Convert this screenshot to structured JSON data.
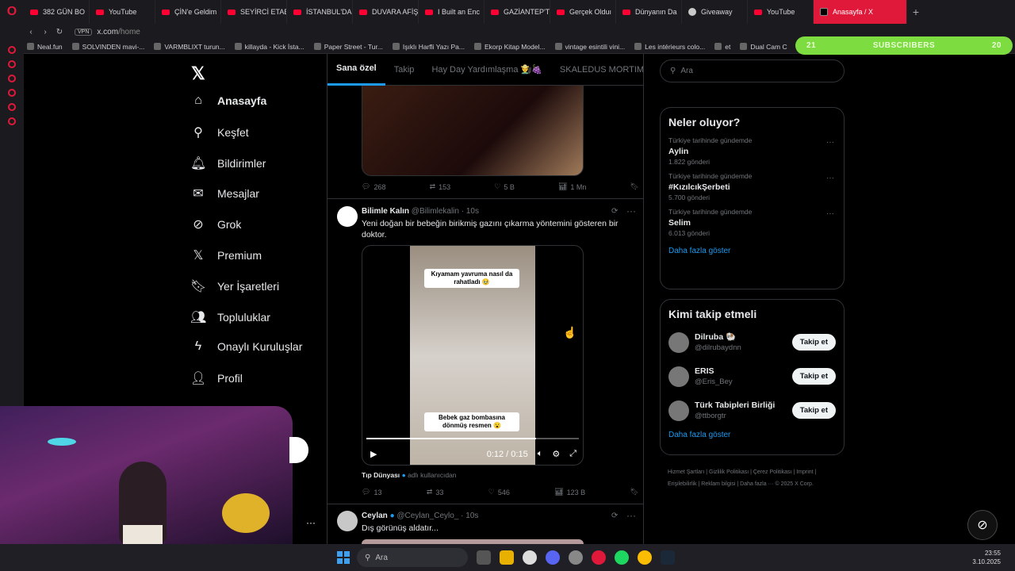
{
  "browser": {
    "tabs": [
      {
        "label": "382 GÜN BO",
        "icon": "yt"
      },
      {
        "label": "YouTube",
        "icon": "yt"
      },
      {
        "label": "ÇİN'e Geldim",
        "icon": "yt"
      },
      {
        "label": "SEYİRCİ ETAB",
        "icon": "yt"
      },
      {
        "label": "İSTANBUL'DA",
        "icon": "yt"
      },
      {
        "label": "DUVARA AFİŞ",
        "icon": "yt"
      },
      {
        "label": "I Built an Enc",
        "icon": "yt"
      },
      {
        "label": "GAZİANTEP'T",
        "icon": "yt"
      },
      {
        "label": "Gerçek Olduı",
        "icon": "yt"
      },
      {
        "label": "Dünyanın Da",
        "icon": "yt"
      },
      {
        "label": "Giveaway",
        "icon": "gh"
      },
      {
        "label": "YouTube",
        "icon": "yt"
      },
      {
        "label": "Anasayfa / X",
        "icon": "x",
        "active": true
      }
    ],
    "vpn": "VPN",
    "url_host": "x.com",
    "url_path": "/home",
    "bookmarks": [
      "Neal.fun",
      "SOLVINDEN mavi-...",
      "VARMBLIXT turun...",
      "killayda - Kick İsta...",
      "Paper Street - Tur...",
      "Işıklı Harfli Yazı Pa...",
      "Ekorp Kitap Model...",
      "vintage esintili vini...",
      "Les intérieurs colo...",
      "et",
      "Dual Cam C"
    ]
  },
  "subs": {
    "left": "21",
    "label": "SUBSCRIBERS",
    "right": "20"
  },
  "nav": [
    {
      "label": "Anasayfa",
      "icon": "home-icon",
      "glyph": "⌂"
    },
    {
      "label": "Keşfet",
      "icon": "search-icon",
      "glyph": "⚲"
    },
    {
      "label": "Bildirimler",
      "icon": "bell-icon",
      "glyph": "🔔︎"
    },
    {
      "label": "Mesajlar",
      "icon": "mail-icon",
      "glyph": "✉"
    },
    {
      "label": "Grok",
      "icon": "grok-icon",
      "glyph": "⊘"
    },
    {
      "label": "Premium",
      "icon": "x-icon",
      "glyph": "𝕏"
    },
    {
      "label": "Yer İşaretleri",
      "icon": "bookmark-icon",
      "glyph": "🔖︎"
    },
    {
      "label": "Topluluklar",
      "icon": "people-icon",
      "glyph": "👥︎"
    },
    {
      "label": "Onaylı Kuruluşlar",
      "icon": "bolt-icon",
      "glyph": "ϟ"
    },
    {
      "label": "Profil",
      "icon": "person-icon",
      "glyph": "👤︎"
    }
  ],
  "timeline": {
    "tabs": [
      "Sana özel",
      "Takip",
      "Hay Day Yardımlaşma 👨‍🌾🍇",
      "SKALEDUS MORTIMAS"
    ],
    "post1": {
      "replies": "268",
      "reposts": "153",
      "likes": "5 B",
      "views": "1 Mn"
    },
    "post2": {
      "name": "Bilimle Kalın",
      "handle": "@Bilimlekalin · 10s",
      "text": "Yeni doğan bir bebeğin birikmiş gazını çıkarma yöntemini gösteren bir doktor.",
      "cap_top": "Kıyamam yavruma nasıl da rahatladı 🥹",
      "cap_bottom": "Bebek gaz bombasına dönmüş resmen 😮",
      "time": "0:12 / 0:15",
      "progress": 0.8,
      "source_name": "Tıp Dünyası",
      "source_suffix": "adlı kullanıcıdan",
      "replies": "13",
      "reposts": "33",
      "likes": "546",
      "views": "123 B"
    },
    "post3": {
      "name": "Ceylan",
      "handle": "@Ceylan_Ceylo_ · 10s",
      "text": "Dış görünüş aldatır..."
    }
  },
  "right": {
    "search_placeholder": "Ara",
    "trends_title": "Neler oluyor?",
    "trends": [
      {
        "context": "Türkiye tarihinde gündemde",
        "name": "Aylin",
        "count": "1.822 gönderi"
      },
      {
        "context": "Türkiye tarihinde gündemde",
        "name": "#KızılcıkŞerbeti",
        "count": "5.700 gönderi"
      },
      {
        "context": "Türkiye tarihinde gündemde",
        "name": "Selim",
        "count": "6.013 gönderi"
      }
    ],
    "show_more": "Daha fazla göster",
    "who_title": "Kimi takip etmeli",
    "who": [
      {
        "name": "Dilruba 🐏",
        "handle": "@dilrubaydnn"
      },
      {
        "name": "ERIS",
        "handle": "@Eris_Bey"
      },
      {
        "name": "Türk Tabipleri Birliği",
        "handle": "@ttborgtr"
      }
    ],
    "follow_label": "Takip et",
    "footer": "Hizmet Şartları | Gizlilik Politikası | Çerez Politikası | Imprint | Erişilebilirlik | Reklam bilgisi | Daha fazla ··· © 2025 X Corp."
  },
  "taskbar": {
    "search": "Ara",
    "time": "23:55",
    "date": "3.10.2025"
  }
}
